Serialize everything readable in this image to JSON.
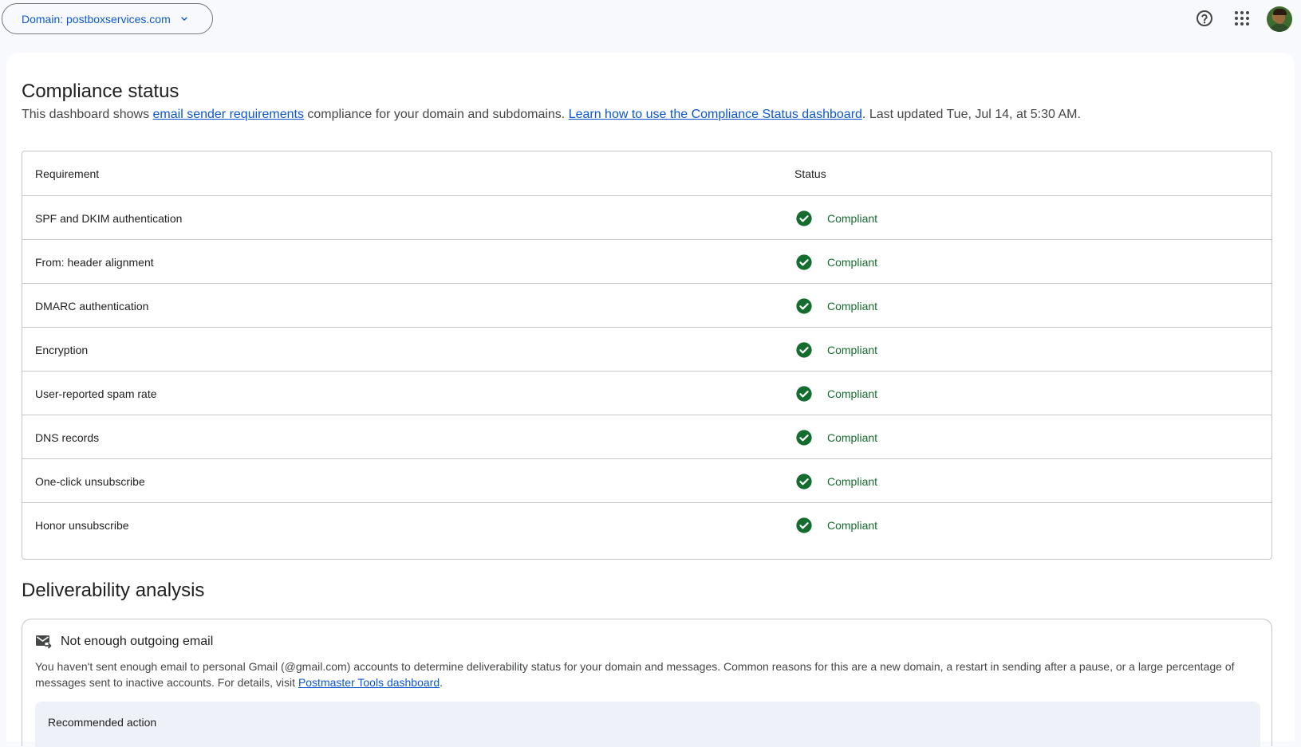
{
  "header": {
    "domain_label": "Domain: postboxservices.com",
    "icons": [
      "help-icon",
      "apps-grid-icon",
      "avatar"
    ]
  },
  "compliance": {
    "title": "Compliance status",
    "desc_prefix": "This dashboard shows ",
    "desc_link1": "email sender requirements",
    "desc_mid": " compliance for your domain and subdomains. ",
    "desc_link2": "Learn how to use the Compliance Status dashboard",
    "desc_suffix": ". Last updated Tue, Jul 14, at 5:30 AM.",
    "table": {
      "headers": [
        "Requirement",
        "Status"
      ],
      "rows": [
        {
          "requirement": "SPF and DKIM authentication",
          "status": "Compliant"
        },
        {
          "requirement": "From: header alignment",
          "status": "Compliant"
        },
        {
          "requirement": "DMARC authentication",
          "status": "Compliant"
        },
        {
          "requirement": "Encryption",
          "status": "Compliant"
        },
        {
          "requirement": "User-reported spam rate",
          "status": "Compliant"
        },
        {
          "requirement": "DNS records",
          "status": "Compliant"
        },
        {
          "requirement": "One-click unsubscribe",
          "status": "Compliant"
        },
        {
          "requirement": "Honor unsubscribe",
          "status": "Compliant"
        }
      ]
    }
  },
  "deliverability": {
    "title": "Deliverability analysis",
    "card_title": "Not enough outgoing email",
    "body_text": "You haven't sent enough email to personal Gmail (@gmail.com) accounts to determine deliverability status for your domain and messages. Common reasons for this are a new domain, a restart in sending after a pause, or a large percentage of messages sent to inactive accounts. For details, visit ",
    "body_link": "Postmaster Tools dashboard",
    "body_end": ".",
    "recommended_label": "Recommended action"
  },
  "colors": {
    "accent": "#0b57d0",
    "compliant": "#146c2e",
    "border": "#c4c7c5"
  }
}
